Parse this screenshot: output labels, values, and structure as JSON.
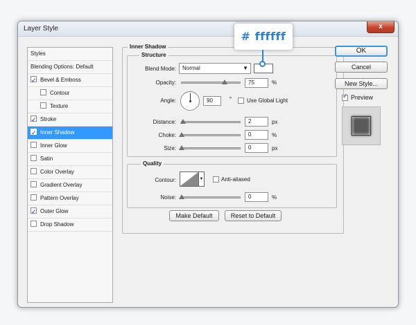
{
  "window": {
    "title": "Layer Style",
    "close_glyph": "x"
  },
  "styles_list": {
    "header": "Styles",
    "blending": "Blending Options: Default",
    "items": [
      {
        "label": "Bevel & Emboss",
        "checked": true
      },
      {
        "label": "Contour",
        "checked": false
      },
      {
        "label": "Texture",
        "checked": false
      },
      {
        "label": "Stroke",
        "checked": true
      },
      {
        "label": "Inner Shadow",
        "checked": true
      },
      {
        "label": "Inner Glow",
        "checked": false
      },
      {
        "label": "Satin",
        "checked": false
      },
      {
        "label": "Color Overlay",
        "checked": false
      },
      {
        "label": "Gradient Overlay",
        "checked": false
      },
      {
        "label": "Pattern Overlay",
        "checked": false
      },
      {
        "label": "Outer Glow",
        "checked": true
      },
      {
        "label": "Drop Shadow",
        "checked": false
      }
    ],
    "selected": "Inner Shadow"
  },
  "panel": {
    "section_title": "Inner Shadow",
    "structure_title": "Structure",
    "blend_mode_label": "Blend Mode:",
    "blend_mode_value": "Normal",
    "blend_color": "#ffffff",
    "opacity_label": "Opacity:",
    "opacity_value": "75",
    "opacity_unit": "%",
    "opacity_level": 0.75,
    "angle_label": "Angle:",
    "angle_value": "90",
    "angle_unit": "°",
    "use_global_light_label": "Use Global Light",
    "distance_label": "Distance:",
    "distance_value": "2",
    "distance_unit": "px",
    "choke_label": "Choke:",
    "choke_value": "0",
    "choke_unit": "%",
    "size_label": "Size:",
    "size_value": "0",
    "size_unit": "px",
    "quality_title": "Quality",
    "contour_label": "Contour:",
    "anti_aliased_label": "Anti-aliased",
    "noise_label": "Noise:",
    "noise_value": "0",
    "noise_unit": "%",
    "make_default_label": "Make Default",
    "reset_default_label": "Reset to Default"
  },
  "buttons": {
    "ok": "OK",
    "cancel": "Cancel",
    "new_style": "New Style...",
    "preview_label": "Preview"
  },
  "callout": {
    "text": "# ffffff",
    "color": "#2f7fd6"
  }
}
